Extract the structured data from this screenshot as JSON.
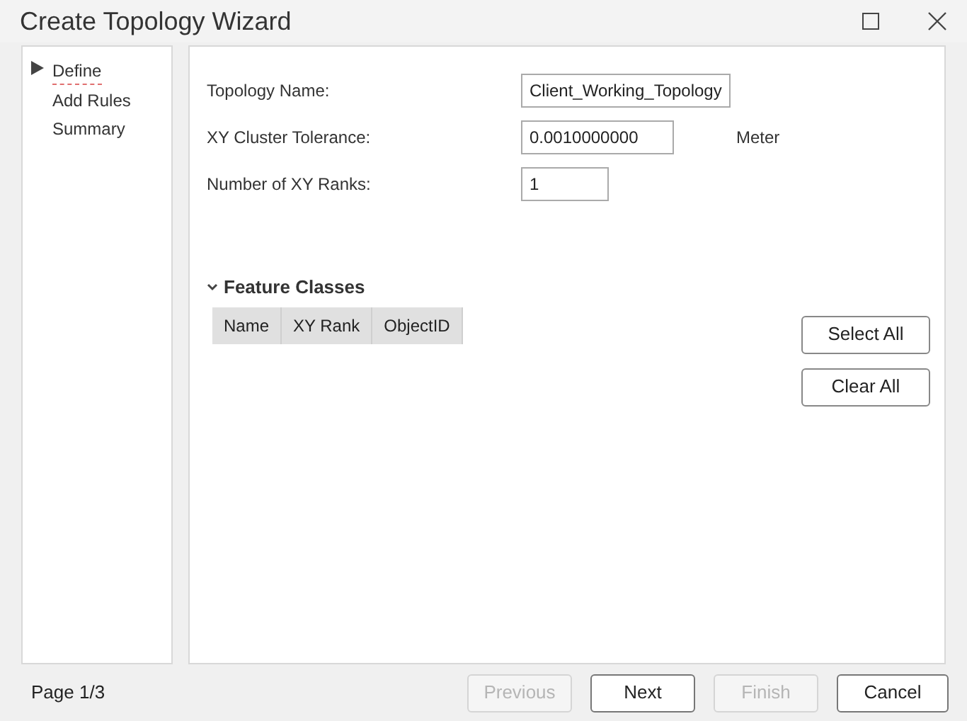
{
  "window": {
    "title": "Create Topology Wizard"
  },
  "steps": [
    {
      "label": "Define",
      "selected": true
    },
    {
      "label": "Add Rules",
      "selected": false
    },
    {
      "label": "Summary",
      "selected": false
    }
  ],
  "fields": [
    {
      "label": "Topology Name:",
      "value": "Client_Working_Topology"
    },
    {
      "label": "XY Cluster Tolerance:",
      "value": "0.0010000000",
      "unit": "Meter"
    },
    {
      "label": "Number of XY Ranks:",
      "value": "1"
    }
  ],
  "feature_classes": {
    "title": "Feature Classes",
    "expanded": true,
    "columns": [
      "Name",
      "XY Rank",
      "ObjectID"
    ],
    "buttons": [
      "Select All",
      "Clear All"
    ]
  },
  "footer": {
    "page": "Page 1/3",
    "buttons": [
      {
        "label": "Previous",
        "disabled": true
      },
      {
        "label": "Next",
        "disabled": false
      },
      {
        "label": "Finish",
        "disabled": true
      },
      {
        "label": "Cancel",
        "disabled": false
      }
    ]
  }
}
